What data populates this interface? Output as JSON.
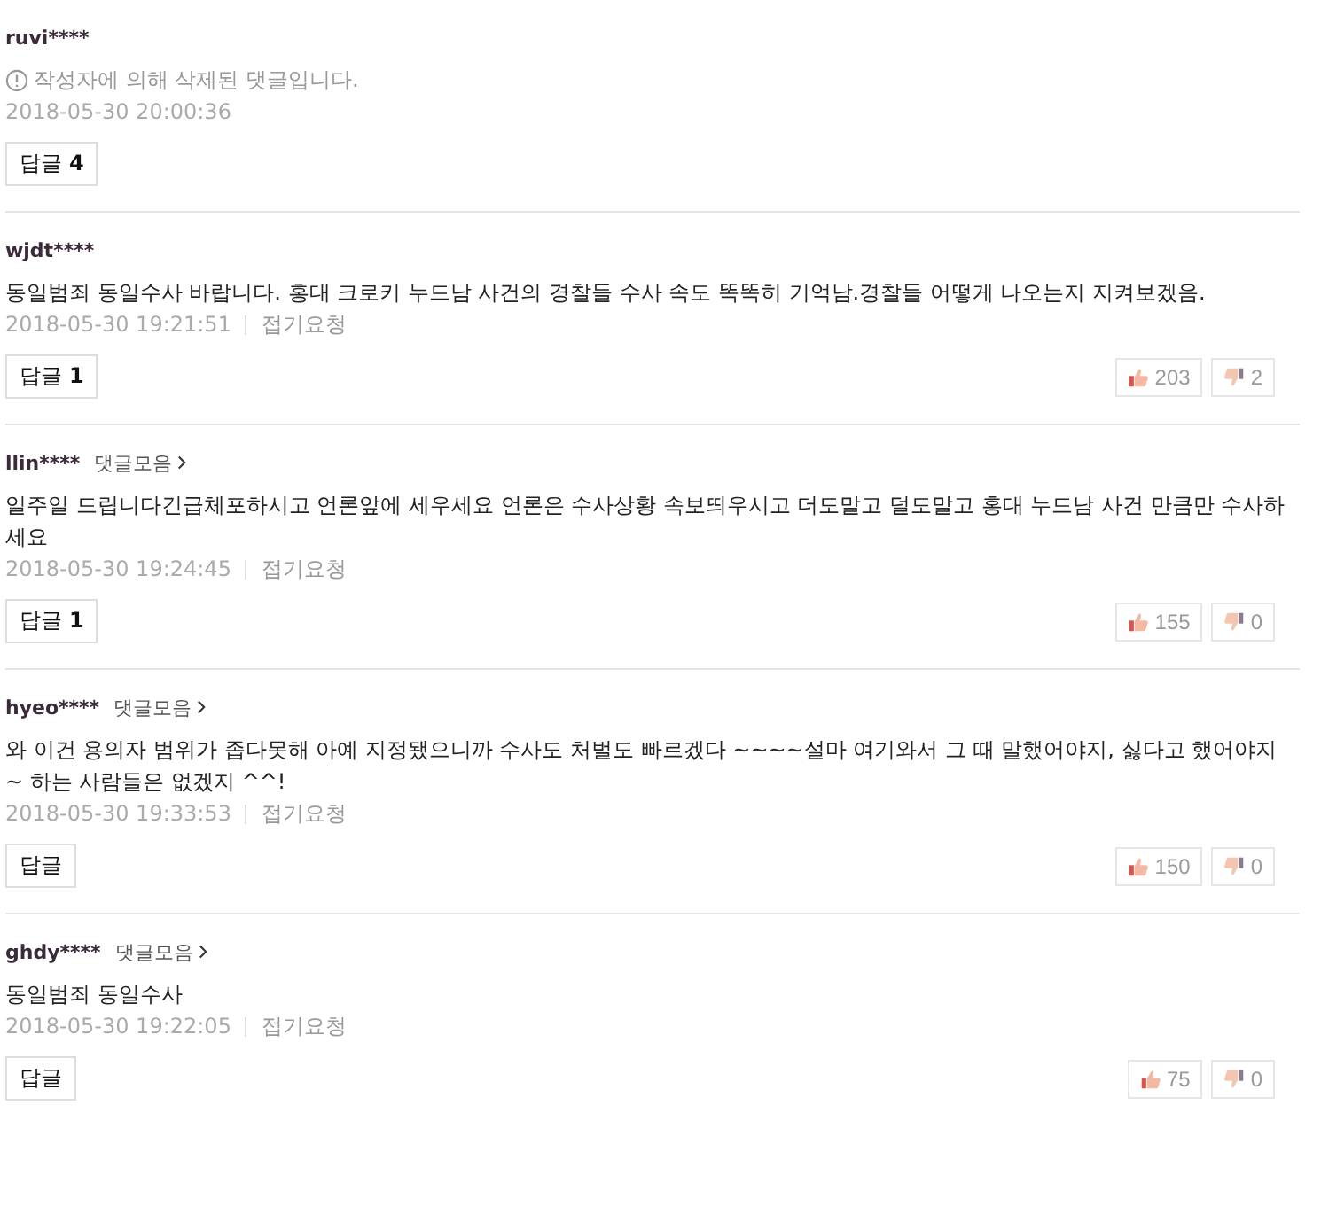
{
  "comments": [
    {
      "user": "ruvi****",
      "deleted": true,
      "text": "작성자에 의해 삭제된 댓글입니다.",
      "time": "2018-05-30 20:00:36",
      "reply": {
        "label": "답글",
        "count": "4"
      }
    },
    {
      "user": "wjdt****",
      "deleted": false,
      "text": "동일범죄 동일수사 바랍니다. 홍대 크로키 누드남 사건의 경찰들 수사 속도 똑똑히 기억남.경찰들 어떻게 나오는지 지켜보겠음.",
      "time": "2018-05-30 19:21:51",
      "report": "접기요청",
      "reply": {
        "label": "답글",
        "count": "1"
      },
      "likes": "203",
      "dislikes": "2"
    },
    {
      "user": "llin****",
      "collection": "댓글모음",
      "deleted": false,
      "text": "일주일 드립니다긴급체포하시고 언론앞에 세우세요 언론은 수사상황 속보띄우시고 더도말고 덜도말고 홍대 누드남 사건 만큼만 수사하세요",
      "time": "2018-05-30 19:24:45",
      "report": "접기요청",
      "reply": {
        "label": "답글",
        "count": "1"
      },
      "likes": "155",
      "dislikes": "0"
    },
    {
      "user": "hyeo****",
      "collection": "댓글모음",
      "deleted": false,
      "text": "와 이건 용의자 범위가 좁다못해 아예 지정됐으니까 수사도 처벌도 빠르겠다 ~~~~설마 여기와서 그 때 말했어야지, 싫다고 했어야지~ 하는 사람들은 없겠지 ^^!",
      "time": "2018-05-30 19:33:53",
      "report": "접기요청",
      "reply": {
        "label": "답글"
      },
      "likes": "150",
      "dislikes": "0"
    },
    {
      "user": "ghdy****",
      "collection": "댓글모음",
      "deleted": false,
      "text": "동일범죄 동일수사",
      "time": "2018-05-30 19:22:05",
      "report": "접기요청",
      "reply": {
        "label": "답글"
      },
      "likes": "75",
      "dislikes": "0"
    }
  ]
}
